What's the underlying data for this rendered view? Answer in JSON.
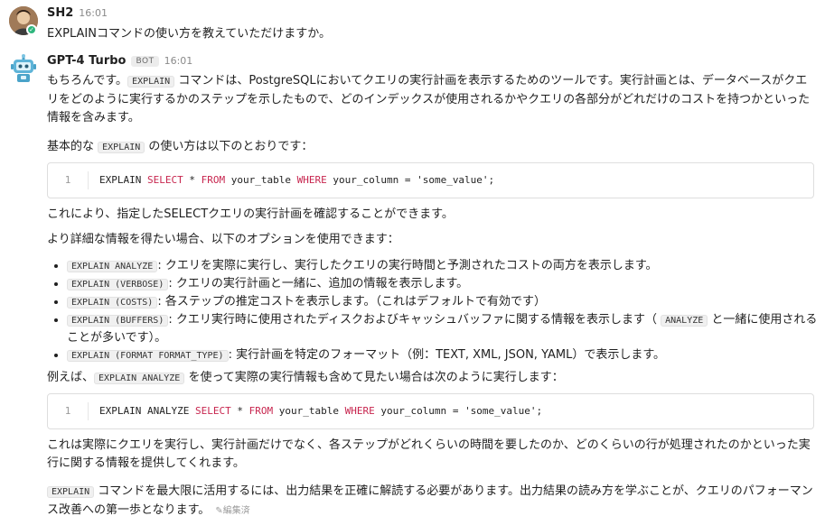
{
  "user_message": {
    "author": "SH2",
    "time": "16:01",
    "text": "EXPLAINコマンドの使い方を教えていただけますか。"
  },
  "bot_message": {
    "author": "GPT-4 Turbo",
    "badge": "BOT",
    "time": "16:01",
    "p1_pre": "もちろんです。",
    "p1_code": "EXPLAIN",
    "p1_post": " コマンドは、PostgreSQLにおいてクエリの実行計画を表示するためのツールです。実行計画とは、データベースがクエリをどのように実行するかのステップを示したもので、どのインデックスが使用されるかやクエリの各部分がどれだけのコストを持つかといった情報を含みます。",
    "p2_pre": "基本的な ",
    "p2_code": "EXPLAIN",
    "p2_post": " の使い方は以下のとおりです：",
    "code1": {
      "line_number": "1",
      "kw1": "EXPLAIN",
      "kw2": "SELECT",
      "star": "*",
      "kw3": "FROM",
      "table": "your_table",
      "kw4": "WHERE",
      "column": "your_column",
      "eq": "=",
      "value": "'some_value';"
    },
    "p3": "これにより、指定したSELECTクエリの実行計画を確認することができます。",
    "p4": "より詳細な情報を得たい場合、以下のオプションを使用できます：",
    "options": [
      {
        "code": "EXPLAIN ANALYZE",
        "desc": ": クエリを実際に実行し、実行したクエリの実行時間と予測されたコストの両方を表示します。"
      },
      {
        "code": "EXPLAIN (VERBOSE)",
        "desc": ": クエリの実行計画と一緒に、追加の情報を表示します。"
      },
      {
        "code": "EXPLAIN (COSTS)",
        "desc": ": 各ステップの推定コストを表示します。（これはデフォルトで有効です）"
      },
      {
        "code": "EXPLAIN (BUFFERS)",
        "desc": ": クエリ実行時に使用されたディスクおよびキャッシュバッファに関する情報を表示します（",
        "code2": "ANALYZE",
        "desc2": " と一緒に使用されることが多いです）。"
      },
      {
        "code": "EXPLAIN (FORMAT FORMAT_TYPE)",
        "desc": ": 実行計画を特定のフォーマット（例：TEXT, XML, JSON, YAML）で表示します。"
      }
    ],
    "p5_pre": "例えば、",
    "p5_code": "EXPLAIN ANALYZE",
    "p5_post": " を使って実際の実行情報も含めて見たい場合は次のように実行します：",
    "code2": {
      "line_number": "1",
      "kw1": "EXPLAIN ANALYZE",
      "kw2": "SELECT",
      "star": "*",
      "kw3": "FROM",
      "table": "your_table",
      "kw4": "WHERE",
      "column": "your_column",
      "eq": "=",
      "value": "'some_value';"
    },
    "p6": "これは実際にクエリを実行し、実行計画だけでなく、各ステップがどれくらいの時間を要したのか、どのくらいの行が処理されたのかといった実行に関する情報を提供してくれます。",
    "p7_code": "EXPLAIN",
    "p7_post": " コマンドを最大限に活用するには、出力結果を正確に解読する必要があります。出力結果の読み方を学ぶことが、クエリのパフォーマンス改善への第一歩となります。",
    "edited_label": "編集済"
  },
  "colors": {
    "keyword": "#c7254e",
    "online": "#2eb67d"
  }
}
